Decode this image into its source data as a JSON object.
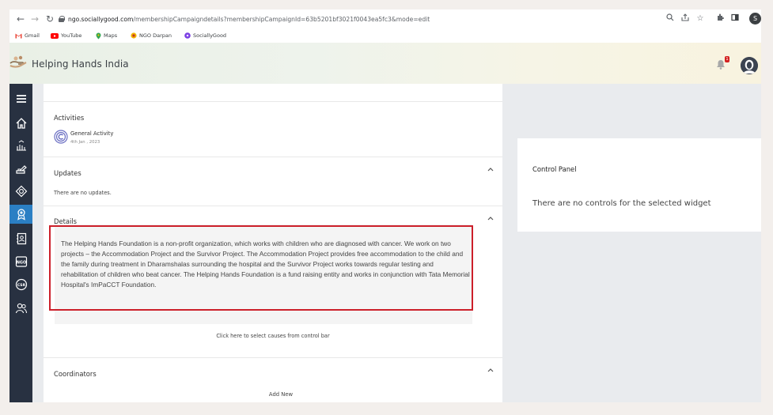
{
  "browser": {
    "url_host": "ngo.sociallygood.com",
    "url_path": "/membershipCampaigndetails?membershipCampaignId=63b5201bf3021f0043ea5fc3&mode=edit",
    "profile_initial": "S",
    "bookmarks": [
      {
        "label": "Gmail",
        "icon": "gmail-icon",
        "color": "#ea4335"
      },
      {
        "label": "YouTube",
        "icon": "youtube-icon",
        "color": "#ff0000"
      },
      {
        "label": "Maps",
        "icon": "maps-icon",
        "color": "#34a853"
      },
      {
        "label": "NGO Darpan",
        "icon": "ngo-darpan-icon",
        "color": "#f4b400"
      },
      {
        "label": "SociallyGood",
        "icon": "sociallygood-icon",
        "color": "#7b3fe4"
      }
    ]
  },
  "header": {
    "brand_name": "Helping Hands India",
    "notification_count": "1"
  },
  "sidebar": {
    "items": [
      {
        "name": "menu",
        "icon": "hamburger-menu-icon"
      },
      {
        "name": "home",
        "icon": "home-icon"
      },
      {
        "name": "donations",
        "icon": "hands-donation-icon"
      },
      {
        "name": "campaigns",
        "icon": "megaphone-icon"
      },
      {
        "name": "programs",
        "icon": "diamond-badge-icon"
      },
      {
        "name": "membership",
        "icon": "award-ribbon-icon",
        "active": true
      },
      {
        "name": "contacts",
        "icon": "address-book-icon"
      },
      {
        "name": "ngo",
        "icon": "ngo-icon"
      },
      {
        "name": "csr",
        "icon": "csr-icon"
      },
      {
        "name": "volunteers",
        "icon": "people-icon"
      }
    ]
  },
  "activities": {
    "title": "Activities",
    "item_title": "General Activity",
    "item_date": "4th Jan , 2023"
  },
  "updates": {
    "title": "Updates",
    "empty_text": "There are no updates."
  },
  "details": {
    "title": "Details",
    "text": "The Helping Hands Foundation is a non-profit organization, which works with children who are diagnosed with cancer. We work on two projects – the Accommodation Project and the Survivor Project. The Accommodation Project provides free accommodation to the child and the family during treatment in Dharamshalas surrounding the hospital and the Survivor Project works towards regular testing and rehabilitation of children who beat cancer. The Helping Hands Foundation is a fund raising entity and works in conjunction with Tata Memorial Hospital's ImPaCCT Foundation.",
    "causes_hint": "Click here to select causes from control bar"
  },
  "coordinators": {
    "title": "Coordinators",
    "add_label": "Add New"
  },
  "control_panel": {
    "title": "Control Panel",
    "empty_text": "There are no controls for the selected widget"
  },
  "colors": {
    "sidebar_bg": "#283141",
    "sidebar_active": "#2b7fc4",
    "highlight": "#cc1f2a"
  }
}
